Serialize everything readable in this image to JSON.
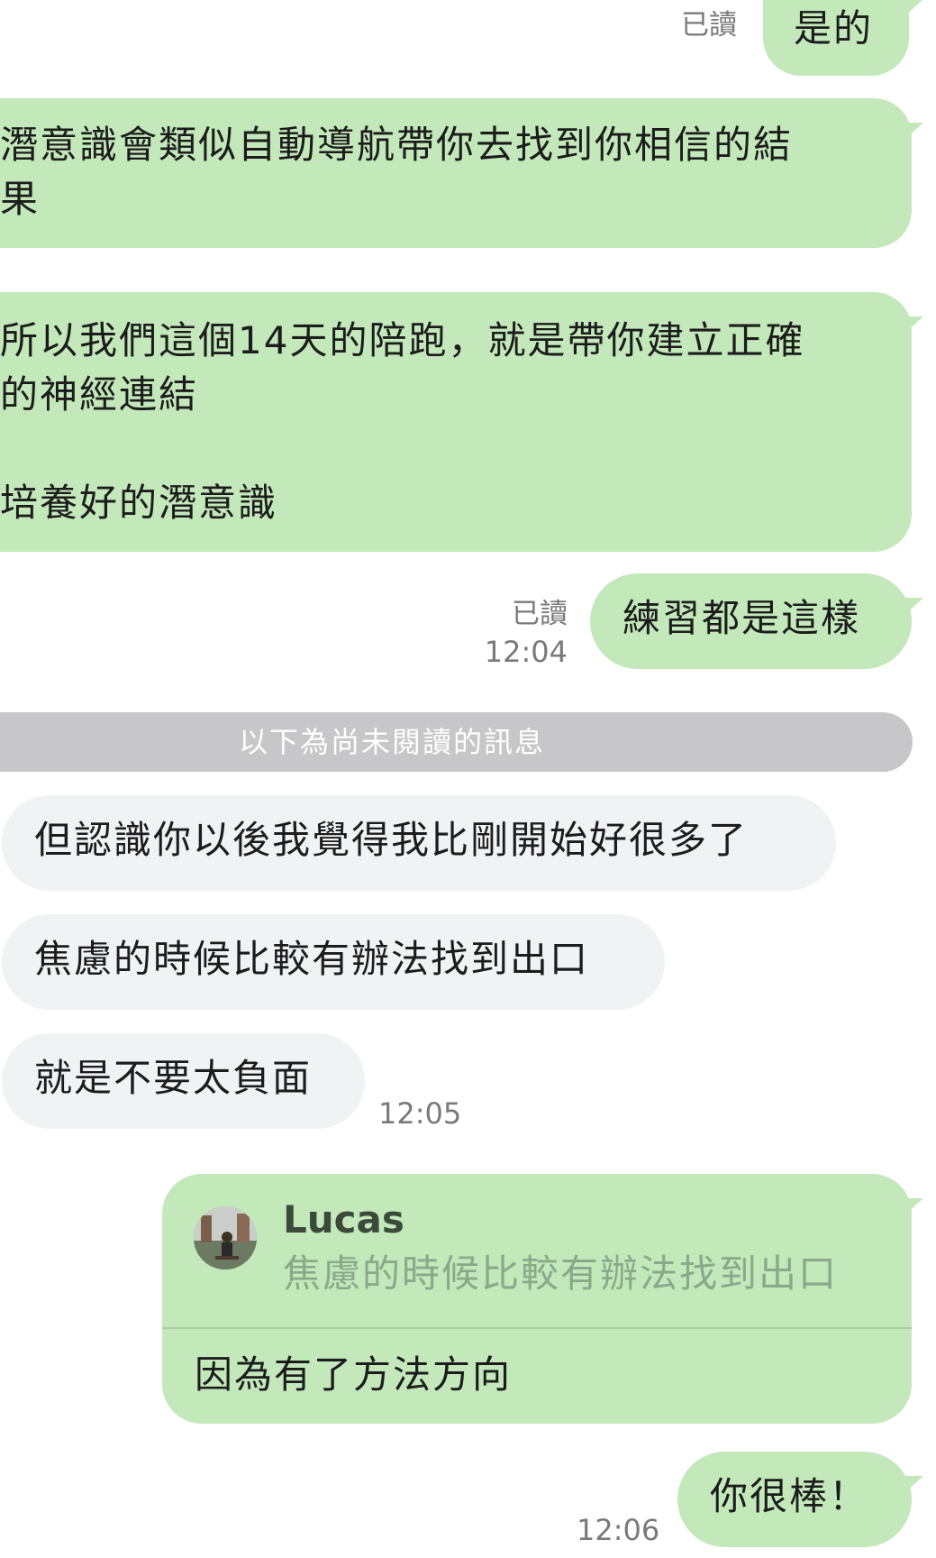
{
  "messages": {
    "m1": {
      "text": "是的",
      "read": "已讀"
    },
    "m2": {
      "text": "潛意識會類似自動導航帶你去找到你相信的結\n果"
    },
    "m3": {
      "text": "所以我們這個14天的陪跑，就是帶你建立正確\n的神經連結\n\n培養好的潛意識"
    },
    "m4": {
      "text": "練習都是這樣",
      "read": "已讀",
      "time": "12:04"
    },
    "divider": "以下為尚未閱讀的訊息",
    "m5": {
      "text": "但認識你以後我覺得我比剛開始好很多了"
    },
    "m6": {
      "text": "焦慮的時候比較有辦法找到出口"
    },
    "m7": {
      "text": "就是不要太負面",
      "time": "12:05"
    },
    "m8": {
      "reply_name": "Lucas",
      "reply_quote": "焦慮的時候比較有辦法找到出口",
      "text": "因為有了方法方向"
    },
    "m9": {
      "text": "你很棒！",
      "time": "12:06"
    }
  },
  "colors": {
    "outgoing_bubble": "#c3e8ba",
    "incoming_bubble": "#f1f2f4",
    "divider": "#c7c7c9"
  }
}
